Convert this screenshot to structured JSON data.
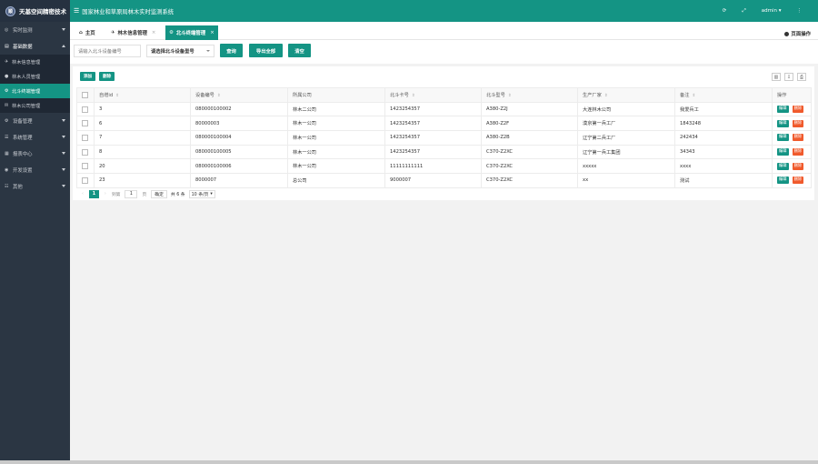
{
  "brand": {
    "logo_text": "顺",
    "name": "天基空间精密技术"
  },
  "header": {
    "menu_icon": "menu-icon",
    "title": "国家林业和草原局林木实时监测系统",
    "refresh_icon": "refresh-icon",
    "fullscreen_icon": "fullscreen-icon",
    "user": "admin ▾",
    "more_icon": "more-vertical-icon"
  },
  "sidebar": {
    "items": [
      {
        "label": "实时监测",
        "icon": "monitor-icon"
      },
      {
        "label": "基础数据",
        "icon": "database-icon"
      },
      {
        "label": "设备管理",
        "icon": "device-icon"
      },
      {
        "label": "系统管理",
        "icon": "settings-icon"
      },
      {
        "label": "报表中心",
        "icon": "report-icon"
      },
      {
        "label": "开发设置",
        "icon": "dev-icon"
      },
      {
        "label": "其他",
        "icon": "other-icon"
      }
    ],
    "sub_items": [
      {
        "label": "林木信息管理"
      },
      {
        "label": "林木人员管理"
      },
      {
        "label": "北斗终端管理"
      },
      {
        "label": "林木公司管理"
      }
    ]
  },
  "tabs": {
    "home": "主页",
    "tab1": "林木信息管理",
    "tab2": "北斗终端管理",
    "close": "×",
    "page_op": "页面操作"
  },
  "search": {
    "device_placeholder": "请输入北斗设备编号",
    "model_select": "请选择北斗设备型号",
    "query_btn": "查询",
    "export_btn": "导出全部",
    "clear_btn": "清空"
  },
  "table": {
    "add_btn": "添加",
    "delete_btn": "删除",
    "headers": [
      "自增id",
      "设备编号",
      "所属公司",
      "北斗卡号",
      "北斗型号",
      "生产厂家",
      "备注",
      "操作"
    ],
    "edit_label": "编辑",
    "del_label": "删除",
    "rows": [
      [
        "3",
        "080000100002",
        "林木二公司",
        "1423254357",
        "A380-Z2J",
        "大连林木公司",
        "我爱兵工"
      ],
      [
        "6",
        "80000003",
        "林木一公司",
        "1423254357",
        "A380-Z2F",
        "漠京第一兵工厂",
        "1843248"
      ],
      [
        "7",
        "080000100004",
        "林木一公司",
        "1423254357",
        "A380-Z2B",
        "辽宁第二兵工厂",
        "242434"
      ],
      [
        "8",
        "080000100005",
        "林木一公司",
        "1423254357",
        "C370-Z2XC",
        "辽宁第一兵工集团",
        "34343"
      ],
      [
        "20",
        "080000100006",
        "林木一公司",
        "11111111111",
        "C370-Z2XC",
        "xxxxx",
        "xxxx"
      ],
      [
        "23",
        "8000007",
        "总公司",
        "9000007",
        "C370-Z2XC",
        "xx",
        "测试"
      ]
    ]
  },
  "pager": {
    "current": "1",
    "goto_label": "到第",
    "page_value": "1",
    "page_unit": "页",
    "confirm": "确定",
    "total": "共 6 条",
    "size": "10 条/页"
  }
}
